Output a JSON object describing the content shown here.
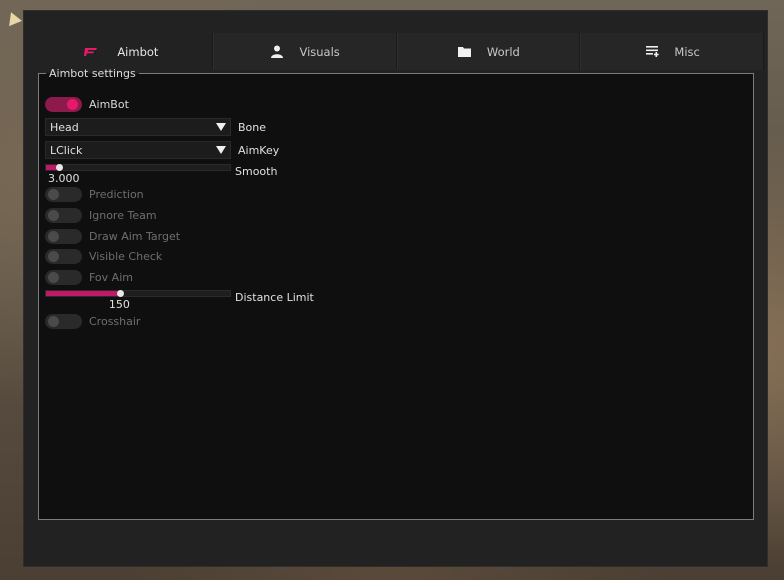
{
  "tabs": [
    {
      "label": "Aimbot",
      "icon": "crosshair-icon",
      "active": true
    },
    {
      "label": "Visuals",
      "icon": "person-icon",
      "active": false
    },
    {
      "label": "World",
      "icon": "folder-icon",
      "active": false
    },
    {
      "label": "Misc",
      "icon": "list-icon",
      "active": false
    }
  ],
  "panel": {
    "title": "Aimbot settings"
  },
  "aimbot_toggle": {
    "label": "AimBot",
    "on": true
  },
  "bone": {
    "value": "Head",
    "label": "Bone"
  },
  "aimkey": {
    "value": "LClick",
    "label": "AimKey"
  },
  "smooth": {
    "label": "Smooth",
    "value": "3.000",
    "fraction": 0.07
  },
  "toggles": [
    {
      "label": "Prediction",
      "on": false
    },
    {
      "label": "Ignore Team",
      "on": false
    },
    {
      "label": "Draw Aim Target",
      "on": false
    },
    {
      "label": "Visible Check",
      "on": false
    },
    {
      "label": "Fov Aim",
      "on": false
    }
  ],
  "distance": {
    "label": "Distance Limit",
    "value": "150",
    "fraction": 0.4
  },
  "crosshair": {
    "label": "Crosshair",
    "on": false
  },
  "colors": {
    "accent": "#e8196a",
    "accent_dark": "#8c1a4d",
    "window": "#222222",
    "panel": "#0f0f0f"
  }
}
